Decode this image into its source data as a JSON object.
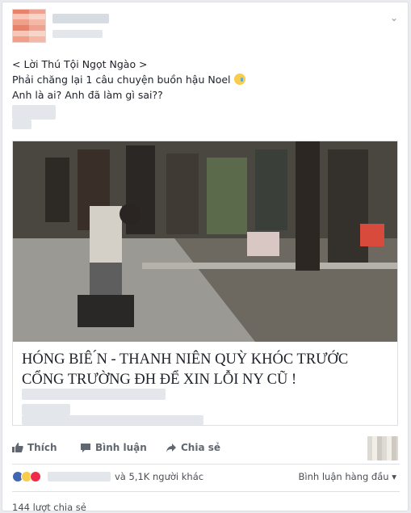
{
  "post": {
    "text_lines": [
      "< Lời Thú Tội Ngọt Ngào >",
      "Phải chăng lại 1 câu chuyện buồn hậu Noel",
      "Anh là ai? Anh đã làm gì sai??"
    ],
    "emoji_icon": "crying-face-emoji"
  },
  "link_preview": {
    "title_line1": "HÓNG BIÊ ́N - THANH NIÊN QUỲ KHÓC TRƯỚC",
    "title_line2": "CỔNG TRƯỜNG ĐH ĐỂ XIN LỖI NY CŨ !"
  },
  "actions": {
    "like_label": "Thích",
    "comment_label": "Bình luận",
    "share_label": "Chia sẻ"
  },
  "reactions": {
    "others_label": "và 5,1K người khác",
    "sort_label": "Bình luận hàng đầu",
    "icons": [
      "like-icon",
      "haha-icon",
      "love-icon"
    ]
  },
  "shares_label": "144 lượt chia sẻ",
  "colors": {
    "like_blue": "#4267b2",
    "haha_yellow": "#f7cd4b",
    "love_red": "#f0284a",
    "meta_gray": "#606770"
  }
}
